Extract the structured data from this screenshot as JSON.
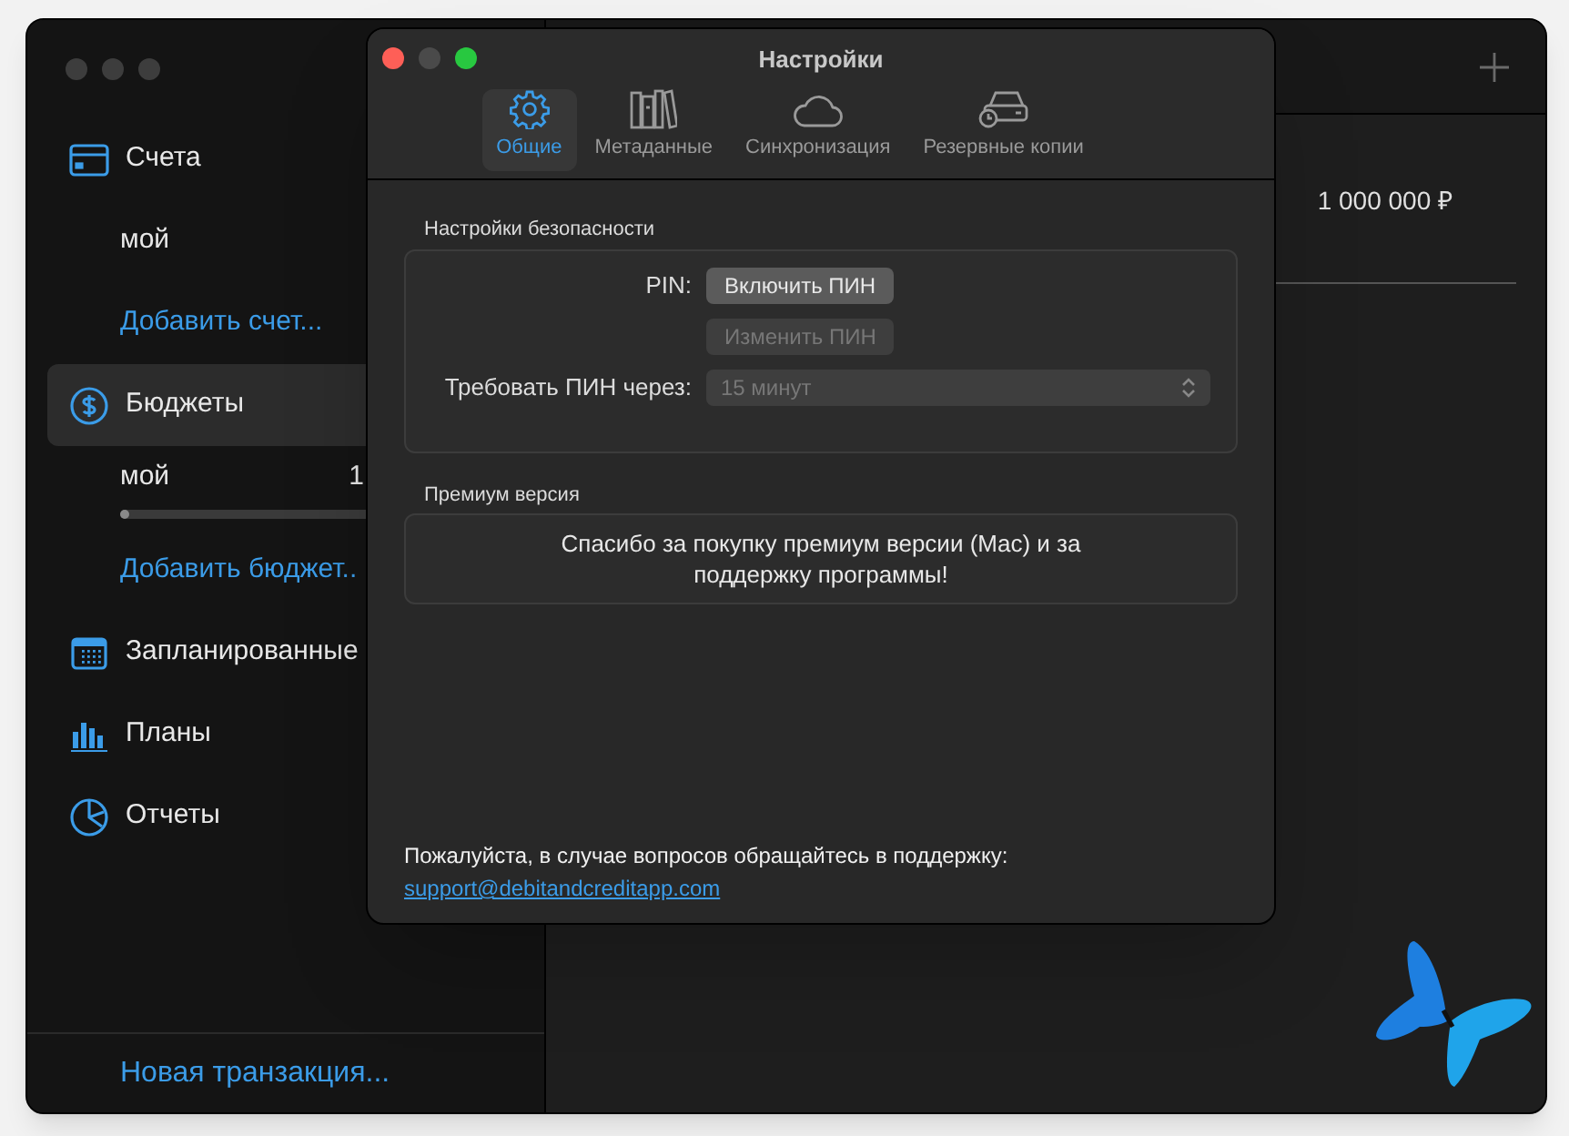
{
  "sidebar": {
    "items": [
      {
        "kind": "section",
        "label": "Счета",
        "selected": false
      },
      {
        "kind": "entry",
        "label": "мой"
      },
      {
        "kind": "link",
        "label": "Добавить счет..."
      },
      {
        "kind": "section",
        "label": "Бюджеты",
        "selected": true
      },
      {
        "kind": "budget",
        "label": "мой",
        "amount": "1",
        "level": 0.02
      },
      {
        "kind": "link",
        "label": "Добавить бюджет.."
      },
      {
        "kind": "section",
        "label": "Запланированные",
        "selected": false
      },
      {
        "kind": "section",
        "label": "Планы",
        "selected": false
      },
      {
        "kind": "section",
        "label": "Отчеты",
        "selected": false
      }
    ],
    "footer_link": "Новая транзакция..."
  },
  "content": {
    "amount": "1 000 000 ₽"
  },
  "dialog": {
    "title": "Настройки",
    "tabs": [
      {
        "label": "Общие",
        "selected": true
      },
      {
        "label": "Метаданные",
        "selected": false
      },
      {
        "label": "Синхронизация",
        "selected": false
      },
      {
        "label": "Резервные копии",
        "selected": false
      }
    ],
    "security": {
      "title": "Настройки безопасности",
      "pin_label": "PIN:",
      "enable_button": {
        "label": "Включить ПИН",
        "disabled": false
      },
      "change_button": {
        "label": "Изменить ПИН",
        "disabled": true
      },
      "require_label": "Требовать ПИН через:",
      "require_select": {
        "value": "15 минут",
        "disabled": true
      }
    },
    "premium": {
      "title": "Премиум версия",
      "message": "Спасибо за покупку премиум версии (Mac) и за поддержку программы!"
    },
    "support_text": "Пожалуйста, в случае вопросов обращайтесь в поддержку:",
    "support_link": "support@debitandcreditapp.com"
  }
}
